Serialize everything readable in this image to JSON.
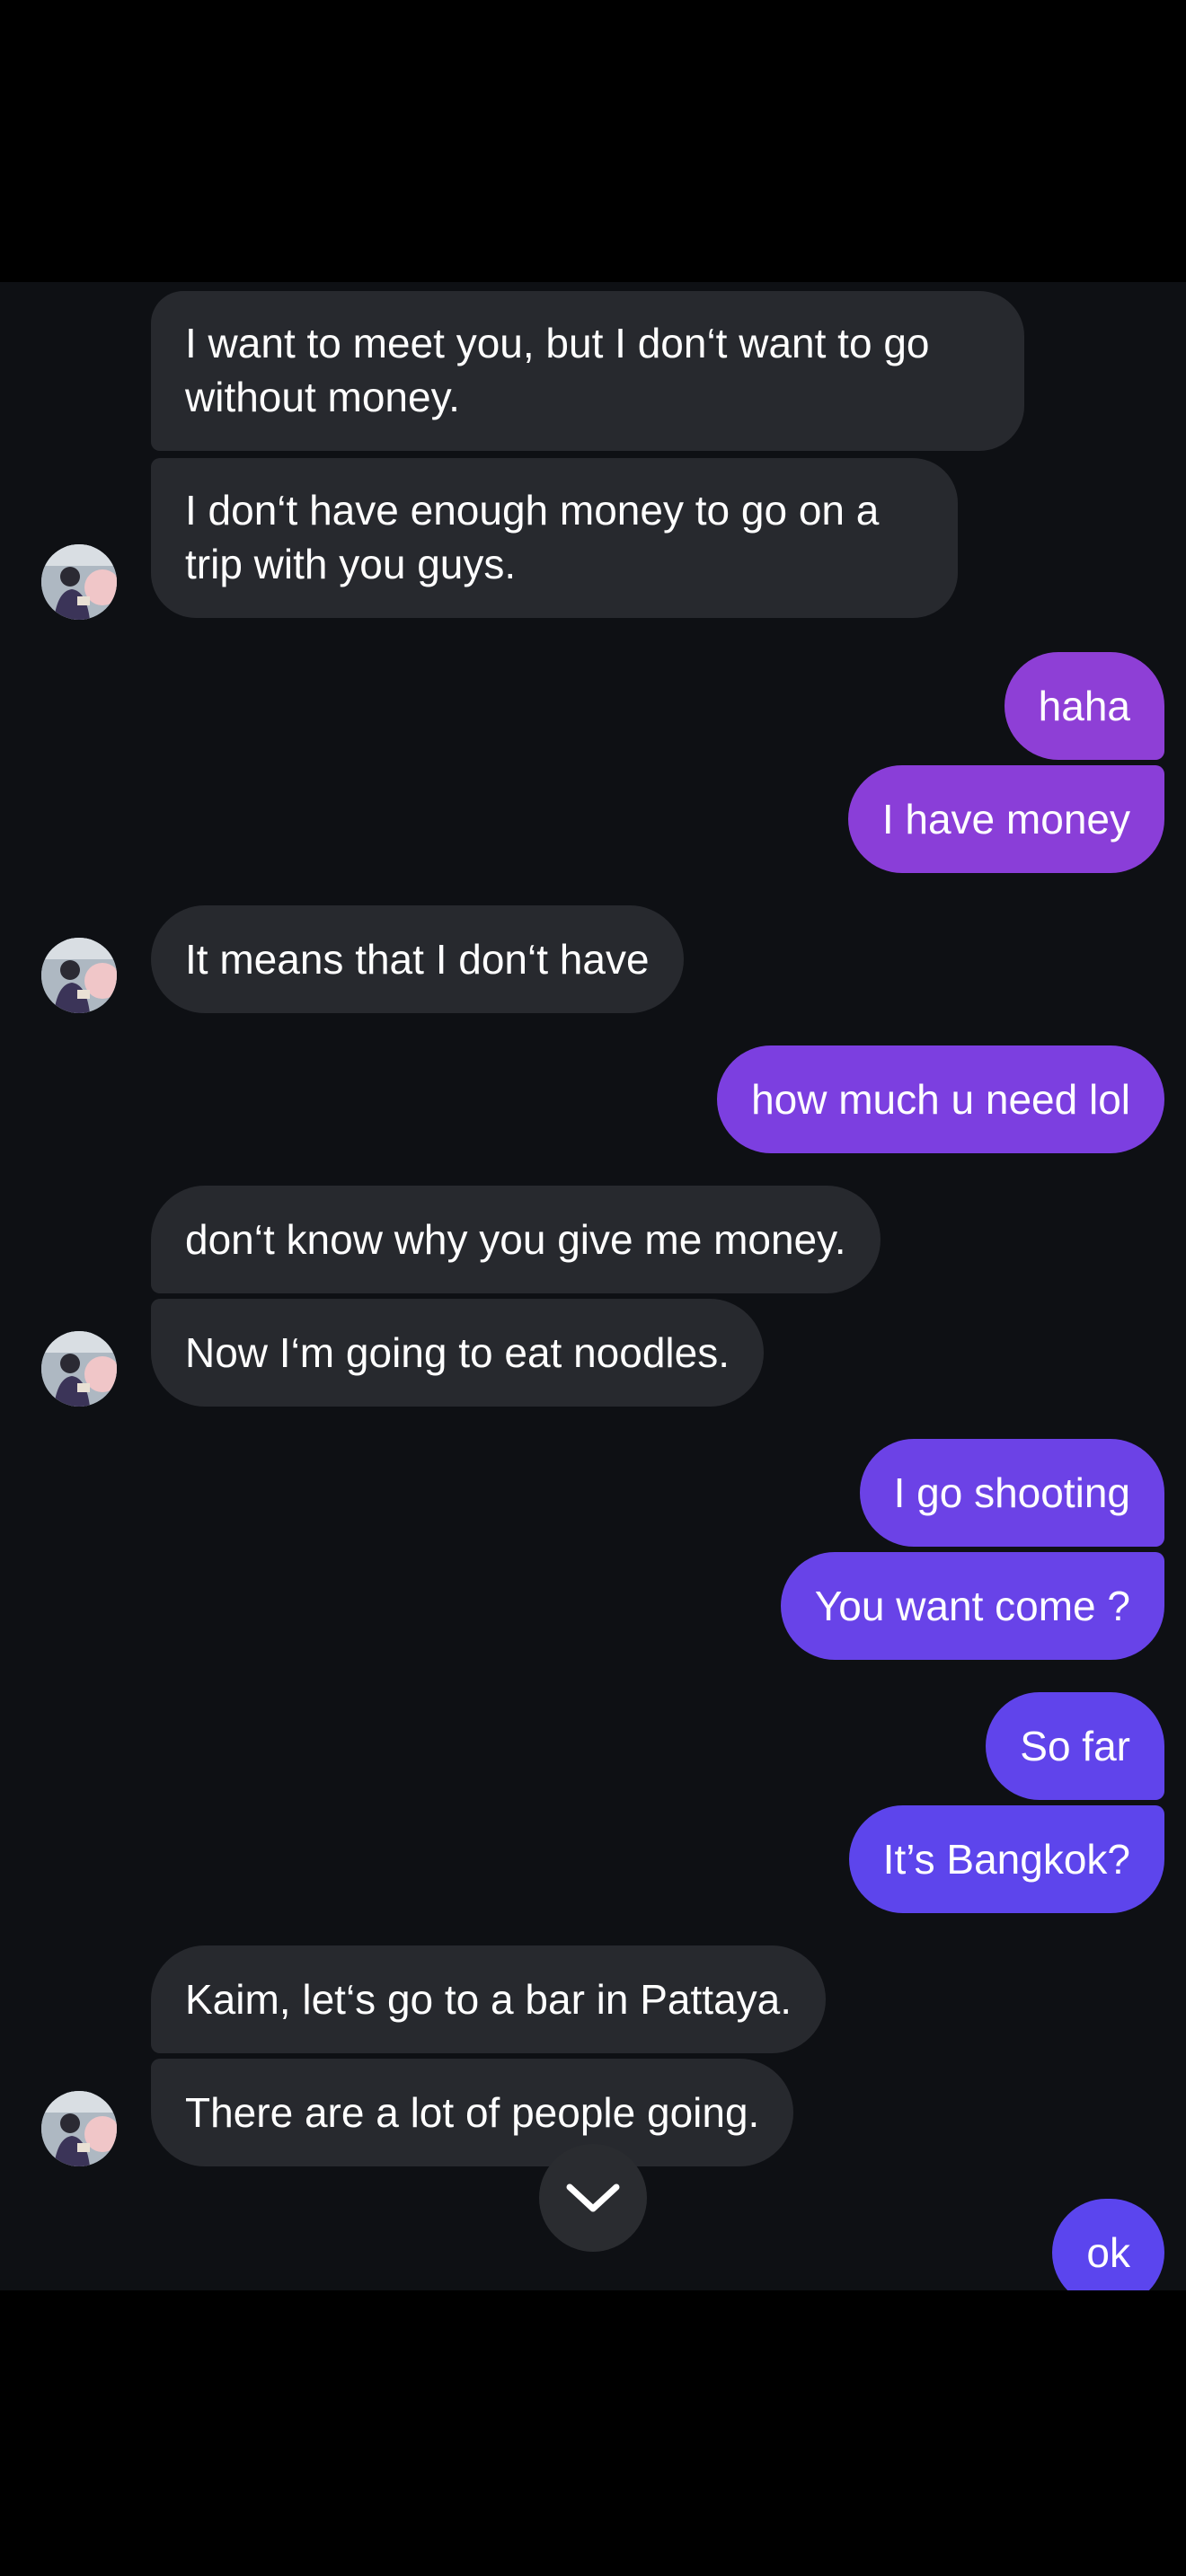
{
  "colors": {
    "chat_background": "#0e1014",
    "incoming_bubble": "#27292e",
    "outgoing_gradient_top": "#8e3fd6",
    "outgoing_gradient_bottom": "#5b45ee",
    "scroll_button": "#2a2c30"
  },
  "messages": [
    {
      "direction": "incoming",
      "text": "I want to meet you, but I don‘t want to go without money."
    },
    {
      "direction": "incoming",
      "text": "I don‘t have enough money to go on a trip with you guys."
    },
    {
      "direction": "outgoing",
      "text": "haha"
    },
    {
      "direction": "outgoing",
      "text": "I have money"
    },
    {
      "direction": "incoming",
      "text": "It means that I don‘t have"
    },
    {
      "direction": "outgoing",
      "text": "how much u need lol"
    },
    {
      "direction": "incoming",
      "text": "don‘t know why you give me money."
    },
    {
      "direction": "incoming",
      "text": "Now I‘m going to eat noodles."
    },
    {
      "direction": "outgoing",
      "text": "I go shooting"
    },
    {
      "direction": "outgoing",
      "text": "You want come ?"
    },
    {
      "direction": "outgoing",
      "text": "So far"
    },
    {
      "direction": "outgoing",
      "text": "It’s Bangkok?"
    },
    {
      "direction": "incoming",
      "text": "Kaim, let‘s go to a bar in Pattaya."
    },
    {
      "direction": "incoming",
      "text": "There are a lot of people going."
    },
    {
      "direction": "outgoing",
      "text": "ok"
    }
  ],
  "icons": {
    "avatar": "contact-avatar-photo",
    "scroll_down": "chevron-down-icon"
  }
}
